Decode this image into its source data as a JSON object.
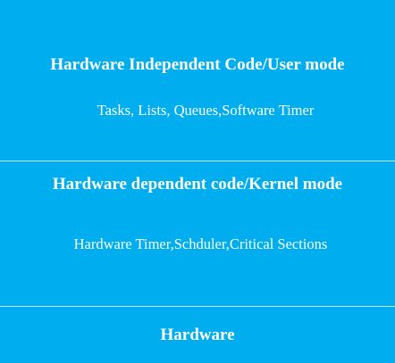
{
  "colors": {
    "background": "#00AEEF",
    "text": "#FFFFFF",
    "divider": "#BFE9FA"
  },
  "layers": [
    {
      "title": "Hardware Independent Code/User mode",
      "description": "Tasks, Lists, Queues,Software Timer"
    },
    {
      "title": "Hardware dependent code/Kernel mode",
      "description": "Hardware Timer,Schduler,Critical Sections"
    },
    {
      "title": "Hardware"
    }
  ]
}
